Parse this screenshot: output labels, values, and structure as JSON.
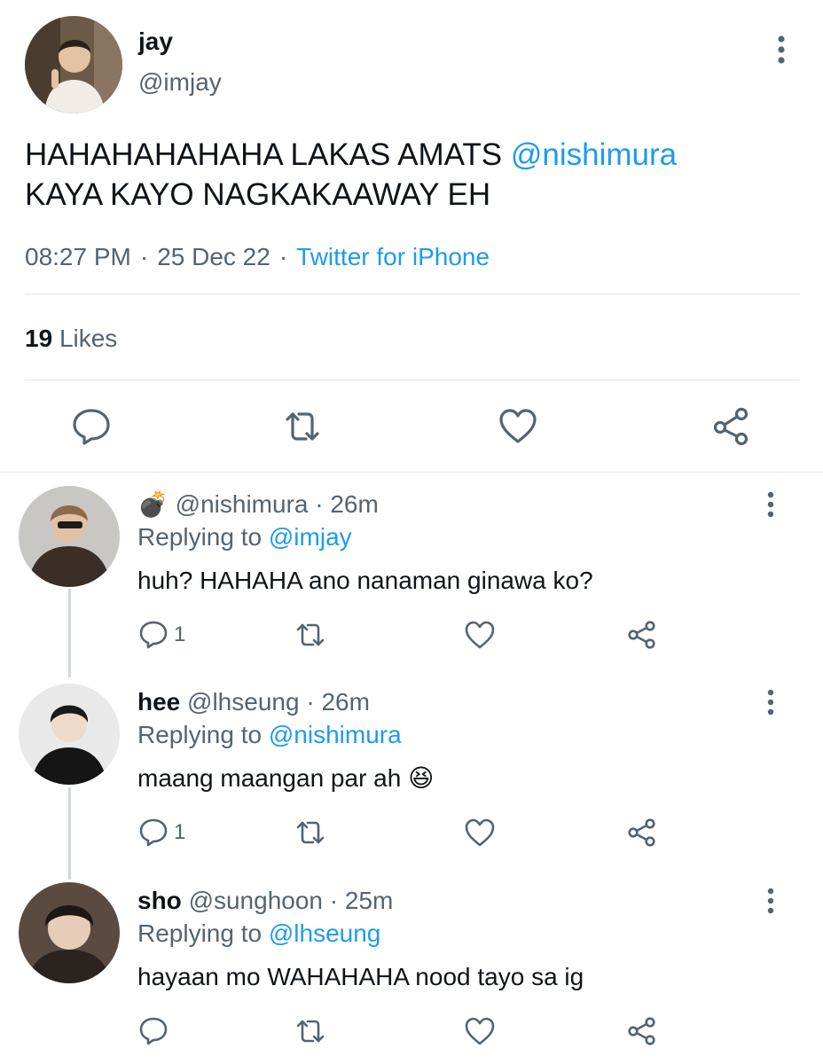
{
  "main_tweet": {
    "name": "jay",
    "handle": "@imjay",
    "text_before": "HAHAHAHAHAHA LAKAS AMATS ",
    "mention": "@nishimura",
    "text_after": "KAYA KAYO NAGKAKAAWAY EH",
    "time": "08:27 PM",
    "date": "25 Dec 22",
    "source": "Twitter for iPhone",
    "separator": "·",
    "likes_count": "19",
    "likes_label": "Likes"
  },
  "replies": [
    {
      "name": "",
      "emoji": "💣",
      "handle": "@nishimura",
      "age": "26m",
      "replying_label": "Replying to",
      "replying_to": "@imjay",
      "text": "huh? HAHAHA ano nanaman ginawa ko?",
      "reply_count": "1"
    },
    {
      "name": "hee",
      "handle": "@lhseung",
      "age": "26m",
      "replying_label": "Replying to",
      "replying_to": "@nishimura",
      "text": "maang maangan par ah 😆",
      "reply_count": "1"
    },
    {
      "name": "sho",
      "handle": "@sunghoon",
      "age": "25m",
      "replying_label": "Replying to",
      "replying_to": "@lhseung",
      "text": "hayaan mo WAHAHAHA nood tayo sa ig",
      "reply_count": ""
    }
  ],
  "colors": {
    "link": "#1d9bf0",
    "secondary_text": "#536471",
    "icon": "#536471",
    "divider": "#dfe3e6"
  },
  "icons": [
    "more-vertical-icon",
    "reply-icon",
    "retweet-icon",
    "like-icon",
    "share-icon"
  ]
}
